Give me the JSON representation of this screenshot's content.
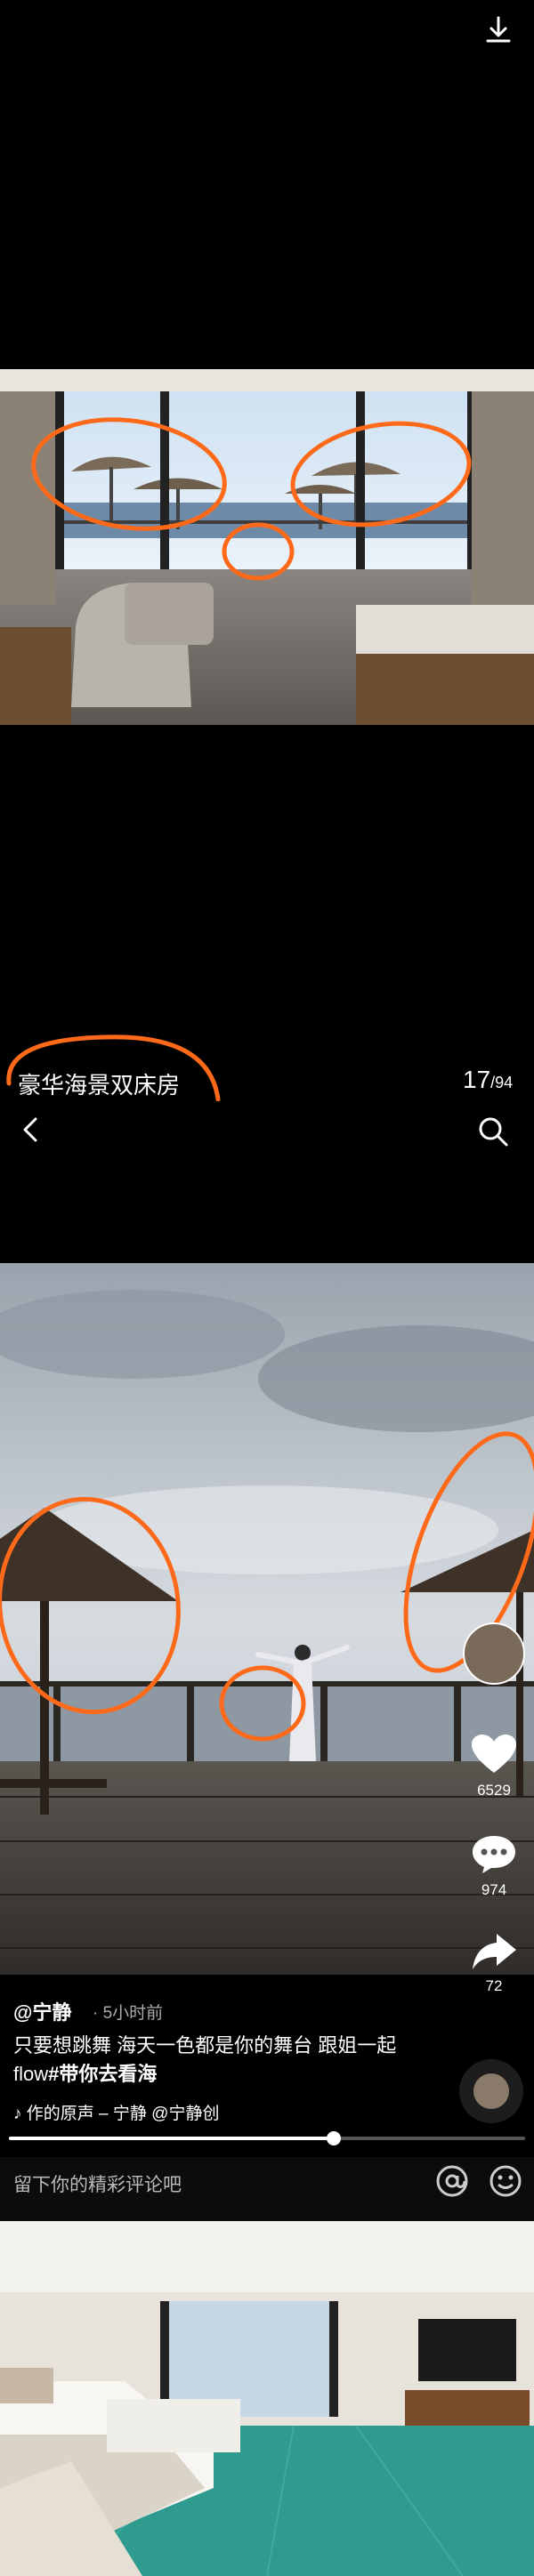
{
  "gallery": {
    "caption": "豪华海景双床房",
    "current_index": "17",
    "total": "/94"
  },
  "post": {
    "author": "@宁静",
    "time": "· 5小时前",
    "text": "只要想跳舞 海天一色都是你的舞台 跟姐一起flow",
    "hashtag": "#带你去看海",
    "music_label": "作的原声 – 宁静    @宁静创",
    "likes": "6529",
    "comments": "974",
    "shares": "72",
    "progress": 0.63
  },
  "comment_bar": {
    "placeholder": "留下你的精彩评论吧"
  },
  "icons": {
    "download": "download-icon",
    "back": "chevron-left-icon",
    "search": "search-icon",
    "like": "heart-icon",
    "comment": "comment-icon",
    "share": "share-icon",
    "mention": "at-icon",
    "emoji": "emoji-icon",
    "music": "music-note-icon"
  },
  "colors": {
    "annotation": "#ff6a1a",
    "background": "#000000"
  }
}
